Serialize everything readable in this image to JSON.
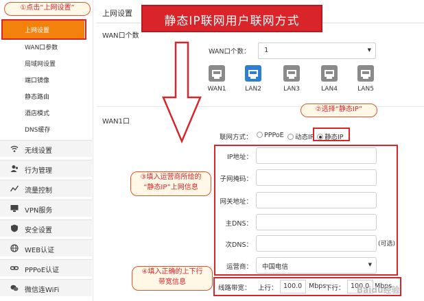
{
  "banner": {
    "title": "静态IP联网用户联网方式"
  },
  "sidebar": {
    "active_item": "上网设置",
    "sub_items": [
      "WAN口参数",
      "局域网设置",
      "端口镜像",
      "静态路由",
      "酒店模式",
      "DNS缓存"
    ],
    "main_items": [
      {
        "label": "无线设置",
        "icon": "wifi-icon"
      },
      {
        "label": "行为管理",
        "icon": "user-icon"
      },
      {
        "label": "流量控制",
        "icon": "chart-icon"
      },
      {
        "label": "VPN服务",
        "icon": "monitor-icon"
      },
      {
        "label": "安全设置",
        "icon": "shield-icon"
      },
      {
        "label": "WEB认证",
        "icon": "globe-icon"
      },
      {
        "label": "PPPoE认证",
        "icon": "link-icon"
      },
      {
        "label": "微信连WiFi",
        "icon": "wechat-icon"
      }
    ]
  },
  "content": {
    "title": "上网设置",
    "wan_count_section": "WAN口个数",
    "wan_count_label": "WAN口个数：",
    "wan_count_value": "1",
    "ports": [
      "WAN1",
      "LAN2",
      "LAN3",
      "LAN4",
      "LAN5"
    ],
    "wan1_section": "WAN1口",
    "connection": {
      "label": "联网方式：",
      "options": [
        "PPPoE",
        "动态IP",
        "静态IP"
      ],
      "selected": "静态IP"
    },
    "fields": {
      "ip_label": "IP地址：",
      "mask_label": "子网掩码：",
      "gateway_label": "网关地址：",
      "dns1_label": "主DNS：",
      "dns2_label": "次DNS：",
      "dns2_note": "(可选)",
      "isp_label": "运营商：",
      "isp_value": "中国电信"
    },
    "bandwidth": {
      "label": "线路带宽：",
      "up_label": "上行：",
      "up_value": "100.0",
      "up_unit": "Mbps",
      "down_label": "下行：",
      "down_value": "100.0",
      "down_unit": "Mbps"
    }
  },
  "annotations": {
    "step1": "①点击“上网设置”",
    "step2": "②选择“静态IP”",
    "step3_line1": "③填入运营商所给的",
    "step3_line2": "“静态IP”上网信息",
    "step4_line1": "④填入正确的上下行",
    "step4_line2": "带宽信息"
  },
  "watermark": "Baidu经验",
  "colors": {
    "accent_orange": "#f2820c",
    "annotation_red": "#d9242a",
    "port_blue": "#2f7fd0"
  }
}
